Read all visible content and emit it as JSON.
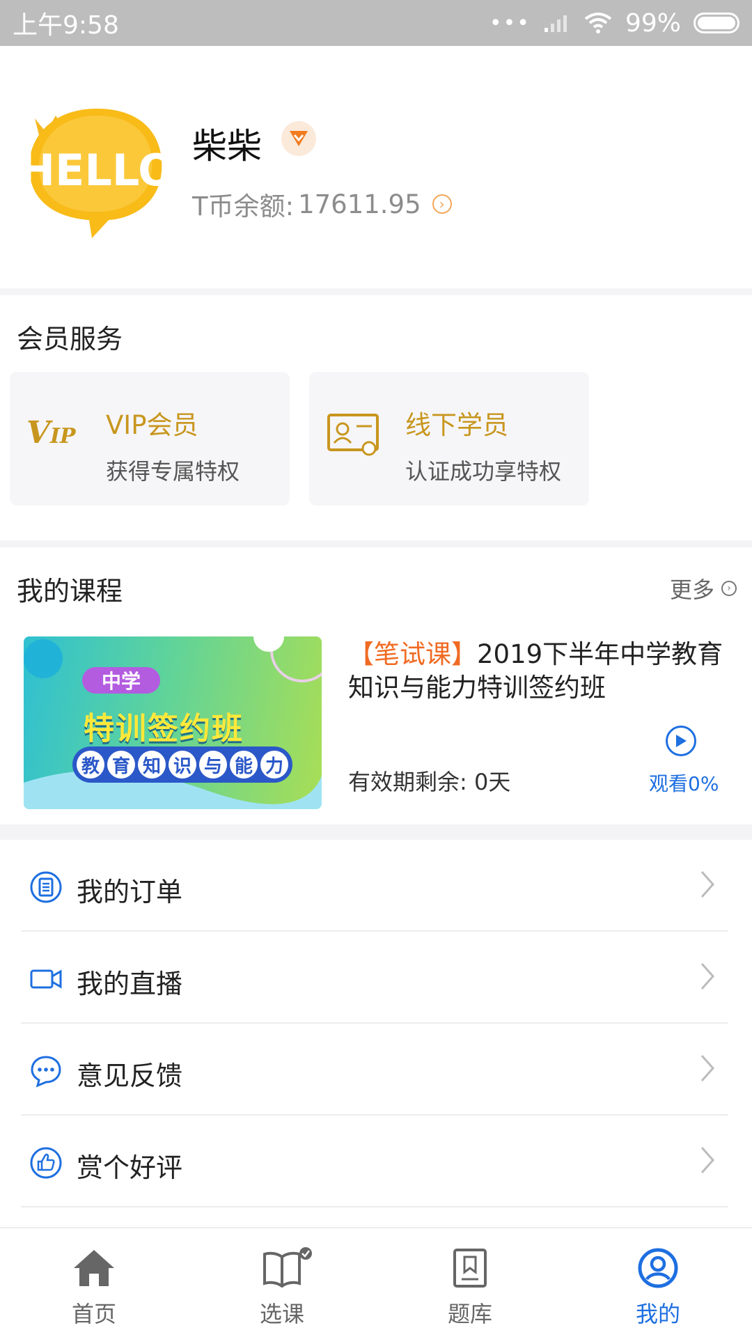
{
  "status_bar": {
    "time": "上午9:58",
    "signal_dots": "•••",
    "battery": "99%"
  },
  "profile": {
    "avatar_text": "HELLO",
    "name": "柴柴",
    "balance_label": "T币余额:",
    "balance_value": "17611.95"
  },
  "member_services": {
    "title": "会员服务",
    "cards": [
      {
        "title": "VIP会员",
        "subtitle": "获得专属特权",
        "icon_text": "VIP"
      },
      {
        "title": "线下学员",
        "subtitle": "认证成功享特权"
      }
    ]
  },
  "my_courses": {
    "title": "我的课程",
    "more": "更多",
    "course": {
      "tag": "【笔试课】",
      "name": "2019下半年中学教育知识与能力特训签约班",
      "expiry": "有效期剩余:  0天",
      "watch": "观看0%",
      "banner": {
        "tag": "中学",
        "title": "特训签约班",
        "sub_chars": [
          "教",
          "育",
          "知",
          "识",
          "与",
          "能",
          "力"
        ]
      }
    }
  },
  "menu": [
    {
      "label": "我的订单",
      "icon": "order-icon"
    },
    {
      "label": "我的直播",
      "icon": "video-icon"
    },
    {
      "label": "意见反馈",
      "icon": "chat-icon"
    },
    {
      "label": "赏个好评",
      "icon": "thumbs-up-icon"
    }
  ],
  "tabs": [
    {
      "label": "首页",
      "icon": "home-icon"
    },
    {
      "label": "选课",
      "icon": "book-icon"
    },
    {
      "label": "题库",
      "icon": "question-bank-icon"
    },
    {
      "label": "我的",
      "icon": "user-icon",
      "active": true
    }
  ],
  "colors": {
    "accent": "#1e6fe0",
    "gold": "#c8961e",
    "orange": "#f06a22"
  }
}
